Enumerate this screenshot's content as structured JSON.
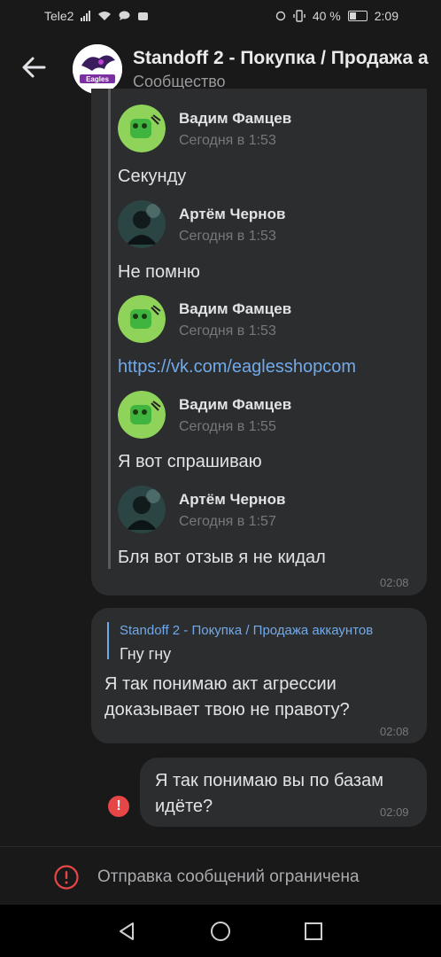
{
  "status": {
    "carrier": "Tele2",
    "battery": "40 %",
    "time": "2:09"
  },
  "header": {
    "title": "Standoff 2 - Покупка / Продажа а",
    "subtitle": "Сообщество",
    "avatar_text": "Eagles"
  },
  "forwarded": [
    {
      "author": "Вадим Фамцев",
      "time": "Сегодня в 1:53",
      "text": "Секунду",
      "avatar": "green"
    },
    {
      "author": "Артём Чернов",
      "time": "Сегодня в 1:53",
      "text": "Не помню",
      "avatar": "dark"
    },
    {
      "author": "Вадим Фамцев",
      "time": "Сегодня в 1:53",
      "text": "https://vk.com/eaglesshopcom",
      "avatar": "green"
    },
    {
      "author": "Вадим Фамцев",
      "time": "Сегодня в 1:55",
      "text": "Я вот спрашиваю",
      "avatar": "green"
    },
    {
      "author": "Артём Чернов",
      "time": "Сегодня в 1:57",
      "text": "Бля вот отзыв я не кидал",
      "avatar": "dark"
    }
  ],
  "message1": {
    "time": "02:08"
  },
  "message2": {
    "reply_title": "Standoff 2 - Покупка / Продажа аккаунтов",
    "reply_text": "Гну гну",
    "line1": "Я так понимаю акт агрессии",
    "line2": "доказывает твою не правоту?",
    "time": "02:08"
  },
  "message3": {
    "line1": "Я так понимаю вы по базам",
    "line2": "идёте?",
    "time": "02:09",
    "error_glyph": "!"
  },
  "footer": {
    "restricted": "Отправка сообщений ограничена"
  },
  "colors": {
    "bg": "#19191a",
    "bubble": "#2c2d2e",
    "link": "#71aaeb",
    "error": "#e64646"
  }
}
